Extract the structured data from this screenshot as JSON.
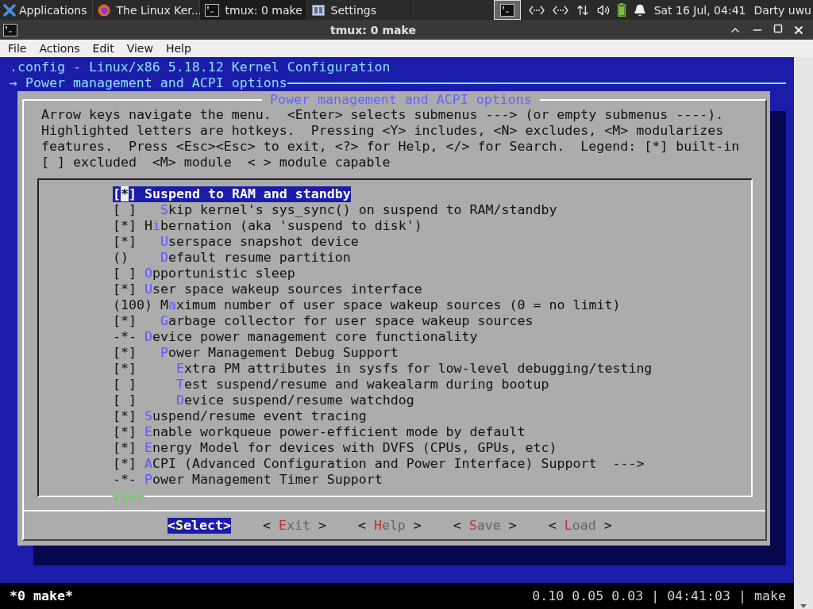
{
  "panel": {
    "app_menu": "Applications",
    "tasks": [
      {
        "label": "The Linux Ker...",
        "kind": "browser",
        "selected": false
      },
      {
        "label": "tmux: 0 make",
        "kind": "terminal",
        "selected": true
      },
      {
        "label": "Settings",
        "kind": "settings",
        "selected": false
      }
    ],
    "clock": "Sat 16 Jul, 04:41",
    "user": "Darty uwu"
  },
  "window": {
    "title": "tmux: 0 make"
  },
  "menu": [
    "File",
    "Actions",
    "Edit",
    "View",
    "Help"
  ],
  "terminal": {
    "header": ".config - Linux/x86 5.18.12 Kernel Configuration",
    "breadcrumb": "→ Power management and ACPI options",
    "dialog": {
      "title": " Power management and ACPI options ",
      "help": [
        "Arrow keys navigate the menu.  <Enter> selects submenus ---> (or empty submenus ----).",
        "Highlighted letters are hotkeys.  Pressing <Y> includes, <N> excludes, <M> modularizes",
        "features.  Press <Esc><Esc> to exit, <?> for Help, </> for Search.  Legend: [*] built-in",
        "[ ] excluded  <M> module  < > module capable"
      ],
      "items": [
        {
          "prefix": "[*]",
          "hotkey": "S",
          "rest": "uspend to RAM and standby",
          "selected": true,
          "children": [
            {
              "prefix": "[ ]",
              "hotkey": "S",
              "rest": "kip kernel's sys_sync() on suspend to RAM/standby",
              "selected": false
            }
          ]
        },
        {
          "prefix": "[*]",
          "before": "H",
          "hotkey": "i",
          "rest": "bernation (aka 'suspend to disk')",
          "selected": false,
          "children": [
            {
              "prefix": "[*]",
              "hotkey": "U",
              "rest": "serspace snapshot device",
              "selected": false
            },
            {
              "prefix": "()",
              "hotkey": "D",
              "rest": "efault resume partition",
              "selected": false
            }
          ]
        },
        {
          "prefix": "[ ]",
          "hotkey": "O",
          "rest": "pportunistic sleep",
          "selected": false
        },
        {
          "prefix": "[*]",
          "hotkey": "U",
          "rest": "ser space wakeup sources interface",
          "selected": false,
          "children": [
            {
              "prefix": "(100)",
              "before": "M",
              "hotkey": "a",
              "rest": "ximum number of user space wakeup sources (0 = no limit)",
              "selected": false
            },
            {
              "prefix": "[*]",
              "hotkey": "G",
              "rest": "arbage collector for user space wakeup sources",
              "selected": false
            }
          ]
        },
        {
          "prefix": "-*-",
          "hotkey": "D",
          "rest": "evice power management core functionality",
          "selected": false,
          "children": [
            {
              "prefix": "[*]",
              "hotkey": "P",
              "rest": "ower Management Debug Support",
              "selected": false,
              "children": [
                {
                  "prefix": "[*]",
                  "hotkey": "E",
                  "rest": "xtra PM attributes in sysfs for low-level debugging/testing",
                  "selected": false
                },
                {
                  "prefix": "[ ]",
                  "hotkey": "T",
                  "rest": "est suspend/resume and wakealarm during bootup",
                  "selected": false
                },
                {
                  "prefix": "[ ]",
                  "hotkey": "D",
                  "rest": "evice suspend/resume watchdog",
                  "selected": false
                }
              ]
            }
          ]
        },
        {
          "prefix": "[*]",
          "hotkey": "S",
          "rest": "uspend/resume event tracing",
          "selected": false
        },
        {
          "prefix": "[*]",
          "hotkey": "E",
          "rest": "nable workqueue power-efficient mode by default",
          "selected": false
        },
        {
          "prefix": "[*]",
          "hotkey": "E",
          "rest": "nergy Model for devices with DVFS (CPUs, GPUs, etc)",
          "selected": false
        },
        {
          "prefix": "[*]",
          "hotkey": "A",
          "rest": "CPI (Advanced Configuration and Power Interface) Support  --->",
          "selected": false
        },
        {
          "prefix": "-*-",
          "hotkey": "P",
          "rest": "ower Management Timer Support",
          "selected": false
        }
      ],
      "more_below": "↓(+)",
      "buttons": [
        {
          "open": "<",
          "hotkey": "S",
          "rest": "elect",
          "close": ">",
          "selected": true
        },
        {
          "open": "< ",
          "hotkey": "E",
          "rest": "xit",
          "close": " >",
          "selected": false
        },
        {
          "open": "< ",
          "hotkey": "H",
          "rest": "elp",
          "close": " >",
          "selected": false
        },
        {
          "open": "< ",
          "hotkey": "S",
          "rest": "ave",
          "close": " >",
          "selected": false
        },
        {
          "open": "< ",
          "hotkey": "L",
          "rest": "oad",
          "close": " >",
          "selected": false
        }
      ]
    }
  },
  "status_bar": {
    "window": "*0 make*",
    "info": "0.10 0.05 0.03 | 04:41:03 | make"
  }
}
